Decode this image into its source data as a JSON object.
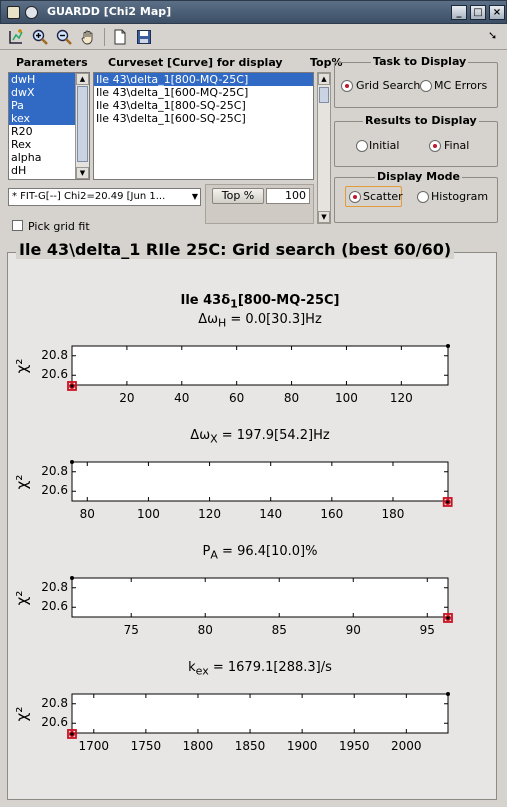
{
  "window": {
    "title": "GUARDD [Chi2 Map]",
    "controls": [
      "_",
      "□",
      "×"
    ]
  },
  "toolbar": {
    "items": [
      "new-point-icon",
      "zoom-in-icon",
      "zoom-out-icon",
      "pan-hand-icon",
      "new-file-icon",
      "save-icon"
    ],
    "corner_arrow": "➘"
  },
  "parameters": {
    "label": "Parameters",
    "items": [
      {
        "label": "dwH",
        "selected": true
      },
      {
        "label": "dwX",
        "selected": true
      },
      {
        "label": "Pa",
        "selected": true
      },
      {
        "label": "kex",
        "selected": true
      },
      {
        "label": "R20",
        "selected": false
      },
      {
        "label": "Rex",
        "selected": false
      },
      {
        "label": "alpha",
        "selected": false
      },
      {
        "label": "dH",
        "selected": false
      }
    ]
  },
  "curveset": {
    "label": "Curveset [Curve] for display",
    "items": [
      {
        "label": "Ile 43\\delta_1[800-MQ-25C]",
        "selected": true
      },
      {
        "label": "Ile 43\\delta_1[600-MQ-25C]",
        "selected": false
      },
      {
        "label": "Ile 43\\delta_1[800-SQ-25C]",
        "selected": false
      },
      {
        "label": "Ile 43\\delta_1[600-SQ-25C]",
        "selected": false
      }
    ]
  },
  "top_percent": {
    "label": "Top%",
    "button_label": "Top %",
    "value": "100"
  },
  "fit_dropdown": {
    "value": "* FIT-G[--] Chi2=20.49 [Jun 1..."
  },
  "pick_grid_fit": {
    "label": "Pick grid fit",
    "checked": false
  },
  "task_group": {
    "title": "Task to Display",
    "options": [
      {
        "label": "Grid Search",
        "selected": true
      },
      {
        "label": "MC Errors",
        "selected": false
      }
    ]
  },
  "results_group": {
    "title": "Results to Display",
    "options": [
      {
        "label": "Initial",
        "selected": false
      },
      {
        "label": "Final",
        "selected": true
      }
    ]
  },
  "mode_group": {
    "title": "Display Mode",
    "options": [
      {
        "label": "Scatter",
        "selected": true
      },
      {
        "label": "Histogram",
        "selected": false
      }
    ]
  },
  "figure": {
    "title": "Ile 43\\delta_1 RIle 25C: Grid search (best 60/60)",
    "top_label_main": "Ile 43δ",
    "top_label_sub": "1",
    "top_label_tail": "[800-MQ-25C]"
  },
  "colors": {
    "selection": "#316ac5",
    "marker": "#cc1122",
    "titlebar": "#3c4f66"
  },
  "chart_data": [
    {
      "type": "scatter",
      "title_main": "Δω",
      "title_sub": "H",
      "title_tail": " = 0.0[30.3]Hz",
      "ylabel": "χ²",
      "xlim": [
        0,
        137
      ],
      "ylim": [
        20.5,
        20.9
      ],
      "xticks": [
        20,
        40,
        60,
        80,
        100,
        120
      ],
      "yticks": [
        20.6,
        20.8
      ],
      "points": [
        [
          0,
          20.49
        ],
        [
          137,
          20.9
        ]
      ],
      "best": [
        0,
        20.49
      ]
    },
    {
      "type": "scatter",
      "title_main": "Δω",
      "title_sub": "X",
      "title_tail": " = 197.9[54.2]Hz",
      "ylabel": "χ²",
      "xlim": [
        75,
        198
      ],
      "ylim": [
        20.5,
        20.9
      ],
      "xticks": [
        80,
        100,
        120,
        140,
        160,
        180
      ],
      "yticks": [
        20.6,
        20.8
      ],
      "points": [
        [
          75,
          20.9
        ],
        [
          197.9,
          20.49
        ]
      ],
      "best": [
        197.9,
        20.49
      ]
    },
    {
      "type": "scatter",
      "title_main": "P",
      "title_sub": "A",
      "title_tail": " = 96.4[10.0]%",
      "ylabel": "χ²",
      "xlim": [
        71,
        96.4
      ],
      "ylim": [
        20.5,
        20.9
      ],
      "xticks": [
        75,
        80,
        85,
        90,
        95
      ],
      "yticks": [
        20.6,
        20.8
      ],
      "points": [
        [
          71,
          20.9
        ],
        [
          96.4,
          20.49
        ]
      ],
      "best": [
        96.4,
        20.49
      ]
    },
    {
      "type": "scatter",
      "title_main": "k",
      "title_sub": "ex",
      "title_tail": " = 1679.1[288.3]/s",
      "ylabel": "χ²",
      "xlim": [
        1679.1,
        2040
      ],
      "ylim": [
        20.5,
        20.9
      ],
      "xticks": [
        1700,
        1750,
        1800,
        1850,
        1900,
        1950,
        2000
      ],
      "yticks": [
        20.6,
        20.8
      ],
      "points": [
        [
          1679.1,
          20.49
        ],
        [
          2040,
          20.9
        ]
      ],
      "best": [
        1679.1,
        20.49
      ]
    }
  ]
}
